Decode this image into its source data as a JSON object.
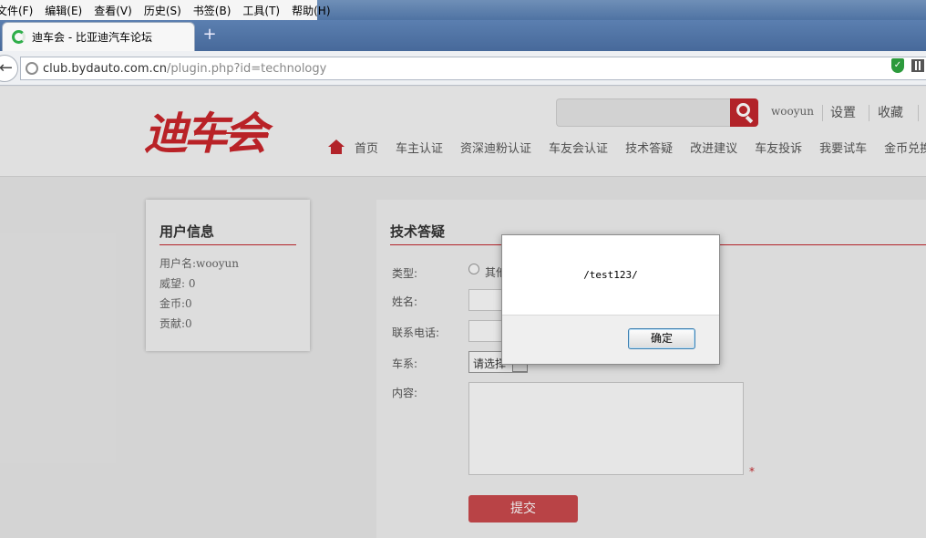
{
  "browser": {
    "menu": [
      "文件(F)",
      "编辑(E)",
      "查看(V)",
      "历史(S)",
      "书签(B)",
      "工具(T)",
      "帮助(H)"
    ],
    "tab_title": "迪车会 - 比亚迪汽车论坛",
    "new_tab": "+",
    "url_host": "club.bydauto.com.cn",
    "url_path": "/plugin.php?id=technology"
  },
  "header": {
    "logo": "迪车会",
    "username": "wooyun",
    "settings": "设置",
    "favorites": "收藏",
    "nav": [
      "首页",
      "车主认证",
      "资深迪粉认证",
      "车友会认证",
      "技术答疑",
      "改进建议",
      "车友投诉",
      "我要试车",
      "金币兑换"
    ]
  },
  "sidebar": {
    "title": "用户信息",
    "rows": [
      "用户名:wooyun",
      "威望: 0",
      "金币:0",
      "贡献:0"
    ]
  },
  "form": {
    "title": "技术答疑",
    "type_label": "类型:",
    "type_option": "其他",
    "name_label": "姓名:",
    "phone_label": "联系电话:",
    "series_label": "车系:",
    "series_value": "请选择",
    "content_label": "内容:",
    "required_mark": "*",
    "submit": "提交"
  },
  "dialog": {
    "message": "/test123/",
    "ok": "确定"
  }
}
